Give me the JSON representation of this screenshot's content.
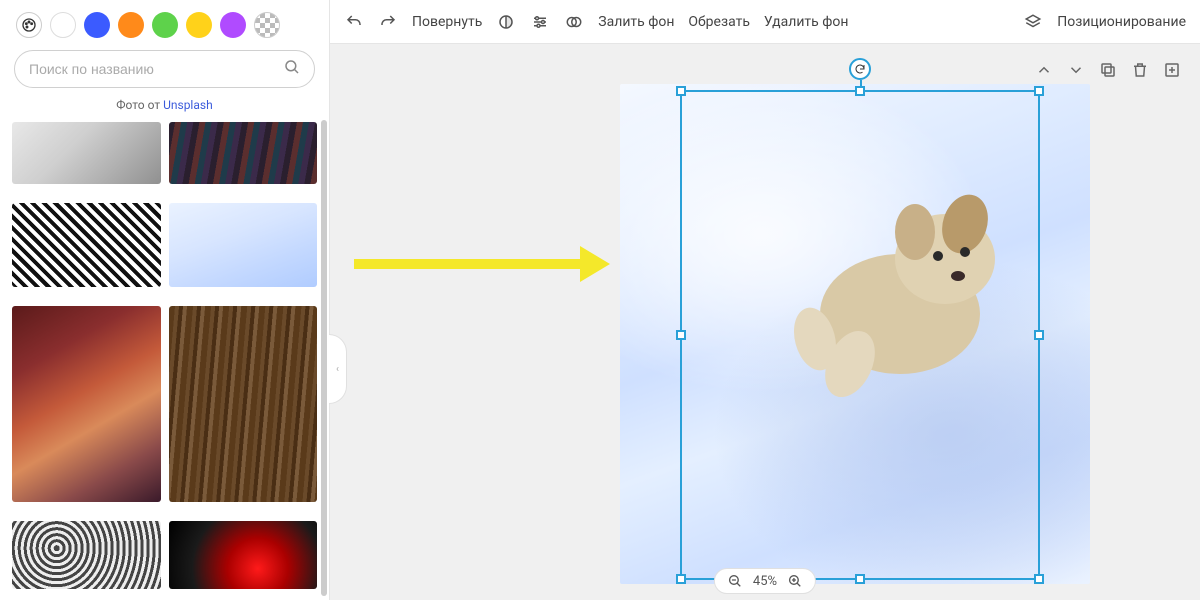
{
  "colors": {
    "swatches": [
      "#ffffff",
      "#3b5bff",
      "#ff8a1a",
      "#5ed24b",
      "#ffd21a",
      "#b04bff"
    ],
    "accent": "#29a0d8"
  },
  "search": {
    "placeholder": "Поиск по названию"
  },
  "credit": {
    "prefix": "Фото от ",
    "link": "Unsplash"
  },
  "toolbar": {
    "rotate": "Повернуть",
    "fill_bg": "Залить фон",
    "crop": "Обрезать",
    "remove_bg": "Удалить фон",
    "positioning": "Позиционирование"
  },
  "zoom": {
    "value": "45%"
  },
  "icons": {
    "undo": "undo-icon",
    "redo": "redo-icon",
    "brightness": "brightness-icon",
    "sliders": "sliders-icon",
    "overlap": "overlap-icon",
    "layers": "layers-icon",
    "up": "chevron-up-icon",
    "down": "chevron-down-icon",
    "copy": "copy-icon",
    "trash": "trash-icon",
    "add": "add-square-icon"
  }
}
